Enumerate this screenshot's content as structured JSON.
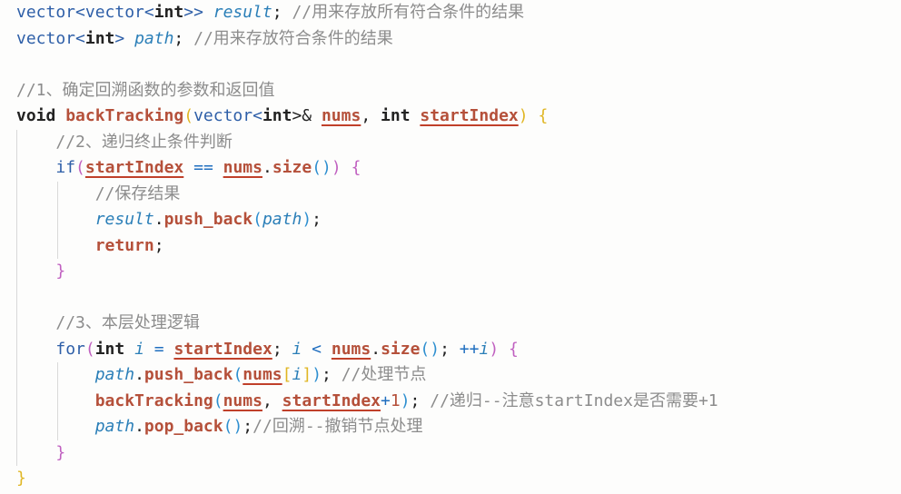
{
  "code_lines": [
    [
      {
        "t": "vector<vector<",
        "c": "kw"
      },
      {
        "t": "int",
        "c": "ty"
      },
      {
        "t": ">> ",
        "c": "kw"
      },
      {
        "t": "result",
        "c": "var"
      },
      {
        "t": "; ",
        "c": "pl"
      },
      {
        "t": "//用来存放所有符合条件的结果",
        "c": "cm"
      }
    ],
    [
      {
        "t": "vector<",
        "c": "kw"
      },
      {
        "t": "int",
        "c": "ty"
      },
      {
        "t": "> ",
        "c": "kw"
      },
      {
        "t": "path",
        "c": "var"
      },
      {
        "t": "; ",
        "c": "pl"
      },
      {
        "t": "//用来存放符合条件的结果",
        "c": "cm"
      }
    ],
    [],
    [
      {
        "t": "//1、确定回溯函数的参数和返回值",
        "c": "cm"
      }
    ],
    [
      {
        "t": "void ",
        "c": "ty"
      },
      {
        "t": "backTracking",
        "c": "fn"
      },
      {
        "t": "(",
        "c": "br1"
      },
      {
        "t": "vector<",
        "c": "kw"
      },
      {
        "t": "int",
        "c": "ty"
      },
      {
        "t": ">& ",
        "c": "pl"
      },
      {
        "t": "nums",
        "c": "param"
      },
      {
        "t": ", ",
        "c": "pl"
      },
      {
        "t": "int ",
        "c": "ty"
      },
      {
        "t": "startIndex",
        "c": "param"
      },
      {
        "t": ") ",
        "c": "br1"
      },
      {
        "t": "{",
        "c": "br1"
      }
    ],
    [
      {
        "t": "    ",
        "c": "pl"
      },
      {
        "t": "//2、递归终止条件判断",
        "c": "cm"
      }
    ],
    [
      {
        "t": "    ",
        "c": "pl"
      },
      {
        "t": "if",
        "c": "kw"
      },
      {
        "t": "(",
        "c": "br2"
      },
      {
        "t": "startIndex",
        "c": "param"
      },
      {
        "t": " == ",
        "c": "op"
      },
      {
        "t": "nums",
        "c": "param"
      },
      {
        "t": ".",
        "c": "pl"
      },
      {
        "t": "size",
        "c": "prop"
      },
      {
        "t": "()",
        "c": "br3"
      },
      {
        "t": ") ",
        "c": "br2"
      },
      {
        "t": "{",
        "c": "br2"
      }
    ],
    [
      {
        "t": "        ",
        "c": "pl"
      },
      {
        "t": "//保存结果",
        "c": "cm"
      }
    ],
    [
      {
        "t": "        ",
        "c": "pl"
      },
      {
        "t": "result",
        "c": "var"
      },
      {
        "t": ".",
        "c": "pl"
      },
      {
        "t": "push_back",
        "c": "prop"
      },
      {
        "t": "(",
        "c": "br3"
      },
      {
        "t": "path",
        "c": "var"
      },
      {
        "t": ")",
        "c": "br3"
      },
      {
        "t": ";",
        "c": "pl"
      }
    ],
    [
      {
        "t": "        ",
        "c": "pl"
      },
      {
        "t": "return",
        "c": "fn"
      },
      {
        "t": ";",
        "c": "pl"
      }
    ],
    [
      {
        "t": "    ",
        "c": "pl"
      },
      {
        "t": "}",
        "c": "br2"
      }
    ],
    [],
    [
      {
        "t": "    ",
        "c": "pl"
      },
      {
        "t": "//3、本层处理逻辑",
        "c": "cm"
      }
    ],
    [
      {
        "t": "    ",
        "c": "pl"
      },
      {
        "t": "for",
        "c": "kw"
      },
      {
        "t": "(",
        "c": "br2"
      },
      {
        "t": "int ",
        "c": "ty"
      },
      {
        "t": "i",
        "c": "var"
      },
      {
        "t": " = ",
        "c": "op"
      },
      {
        "t": "startIndex",
        "c": "param"
      },
      {
        "t": "; ",
        "c": "pl"
      },
      {
        "t": "i",
        "c": "var"
      },
      {
        "t": " < ",
        "c": "op"
      },
      {
        "t": "nums",
        "c": "param"
      },
      {
        "t": ".",
        "c": "pl"
      },
      {
        "t": "size",
        "c": "prop"
      },
      {
        "t": "()",
        "c": "br3"
      },
      {
        "t": "; ",
        "c": "pl"
      },
      {
        "t": "++",
        "c": "op"
      },
      {
        "t": "i",
        "c": "var"
      },
      {
        "t": ") ",
        "c": "br2"
      },
      {
        "t": "{",
        "c": "br2"
      }
    ],
    [
      {
        "t": "        ",
        "c": "pl"
      },
      {
        "t": "path",
        "c": "var"
      },
      {
        "t": ".",
        "c": "pl"
      },
      {
        "t": "push_back",
        "c": "prop"
      },
      {
        "t": "(",
        "c": "br3"
      },
      {
        "t": "nums",
        "c": "param"
      },
      {
        "t": "[",
        "c": "br1"
      },
      {
        "t": "i",
        "c": "var"
      },
      {
        "t": "]",
        "c": "br1"
      },
      {
        "t": ")",
        "c": "br3"
      },
      {
        "t": "; ",
        "c": "pl"
      },
      {
        "t": "//处理节点",
        "c": "cm"
      }
    ],
    [
      {
        "t": "        ",
        "c": "pl"
      },
      {
        "t": "backTracking",
        "c": "fn"
      },
      {
        "t": "(",
        "c": "br3"
      },
      {
        "t": "nums",
        "c": "param"
      },
      {
        "t": ", ",
        "c": "pl"
      },
      {
        "t": "startIndex",
        "c": "param"
      },
      {
        "t": "+",
        "c": "op"
      },
      {
        "t": "1",
        "c": "num"
      },
      {
        "t": ")",
        "c": "br3"
      },
      {
        "t": "; ",
        "c": "pl"
      },
      {
        "t": "//递归--注意startIndex是否需要+1",
        "c": "cm"
      }
    ],
    [
      {
        "t": "        ",
        "c": "pl"
      },
      {
        "t": "path",
        "c": "var"
      },
      {
        "t": ".",
        "c": "pl"
      },
      {
        "t": "pop_back",
        "c": "prop"
      },
      {
        "t": "()",
        "c": "br3"
      },
      {
        "t": ";",
        "c": "pl"
      },
      {
        "t": "//回溯--撤销节点处理",
        "c": "cm"
      }
    ],
    [
      {
        "t": "    ",
        "c": "pl"
      },
      {
        "t": "}",
        "c": "br2"
      }
    ],
    [
      {
        "t": "}",
        "c": "br1"
      }
    ]
  ]
}
